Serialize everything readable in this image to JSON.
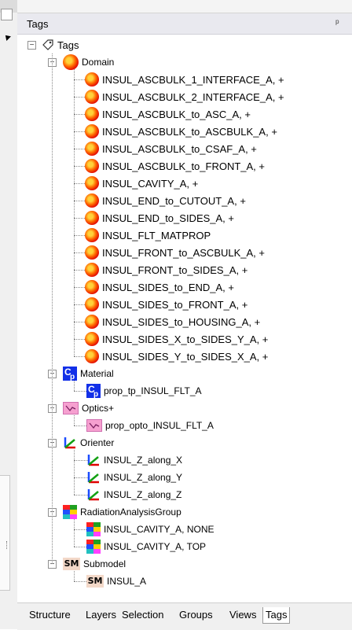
{
  "panel": {
    "title": "Tags",
    "pin_glyph": "ᵖ"
  },
  "tree": {
    "root": "Tags",
    "domain": {
      "label": "Domain",
      "items": [
        "INSUL_ASCBULK_1_INTERFACE_A, +",
        "INSUL_ASCBULK_2_INTERFACE_A, +",
        "INSUL_ASCBULK_to_ASC_A, +",
        "INSUL_ASCBULK_to_ASCBULK_A, +",
        "INSUL_ASCBULK_to_CSAF_A, +",
        "INSUL_ASCBULK_to_FRONT_A, +",
        "INSUL_CAVITY_A, +",
        "INSUL_END_to_CUTOUT_A, +",
        "INSUL_END_to_SIDES_A, +",
        "INSUL_FLT_MATPROP",
        "INSUL_FRONT_to_ASCBULK_A, +",
        "INSUL_FRONT_to_SIDES_A, +",
        "INSUL_SIDES_to_END_A, +",
        "INSUL_SIDES_to_FRONT_A, +",
        "INSUL_SIDES_to_HOUSING_A, +",
        "INSUL_SIDES_X_to_SIDES_Y_A, +",
        "INSUL_SIDES_Y_to_SIDES_X_A, +"
      ]
    },
    "material": {
      "label": "Material",
      "items": [
        "prop_tp_INSUL_FLT_A"
      ]
    },
    "optics": {
      "label": "Optics+",
      "items": [
        "prop_opto_INSUL_FLT_A"
      ]
    },
    "orienter": {
      "label": "Orienter",
      "items": [
        "INSUL_Z_along_X",
        "INSUL_Z_along_Y",
        "INSUL_Z_along_Z"
      ]
    },
    "radiation": {
      "label": "RadiationAnalysisGroup",
      "items": [
        "INSUL_CAVITY_A, NONE",
        "INSUL_CAVITY_A, TOP"
      ]
    },
    "submodel": {
      "label": "Submodel",
      "items": [
        "INSUL_A"
      ]
    }
  },
  "icons": {
    "root": "tag-icon",
    "domain": "domain-ball-icon",
    "material": "cp-material-icon",
    "optics": "optics-icon",
    "orienter": "orienter-axes-icon",
    "radiation": "radiation-group-icon",
    "submodel": "submodel-sm-icon",
    "sm_text": "SM"
  },
  "tabs": [
    "Structure",
    "Layers",
    "Selection",
    "Groups",
    "Views",
    "Tags"
  ],
  "active_tab": "Tags",
  "expanders": {
    "collapse": "−"
  },
  "colors": {
    "ball": "#e00000",
    "cp": "#1230e8",
    "optics": "#f6a0d0",
    "sm_bg": "#f3d8c8"
  }
}
